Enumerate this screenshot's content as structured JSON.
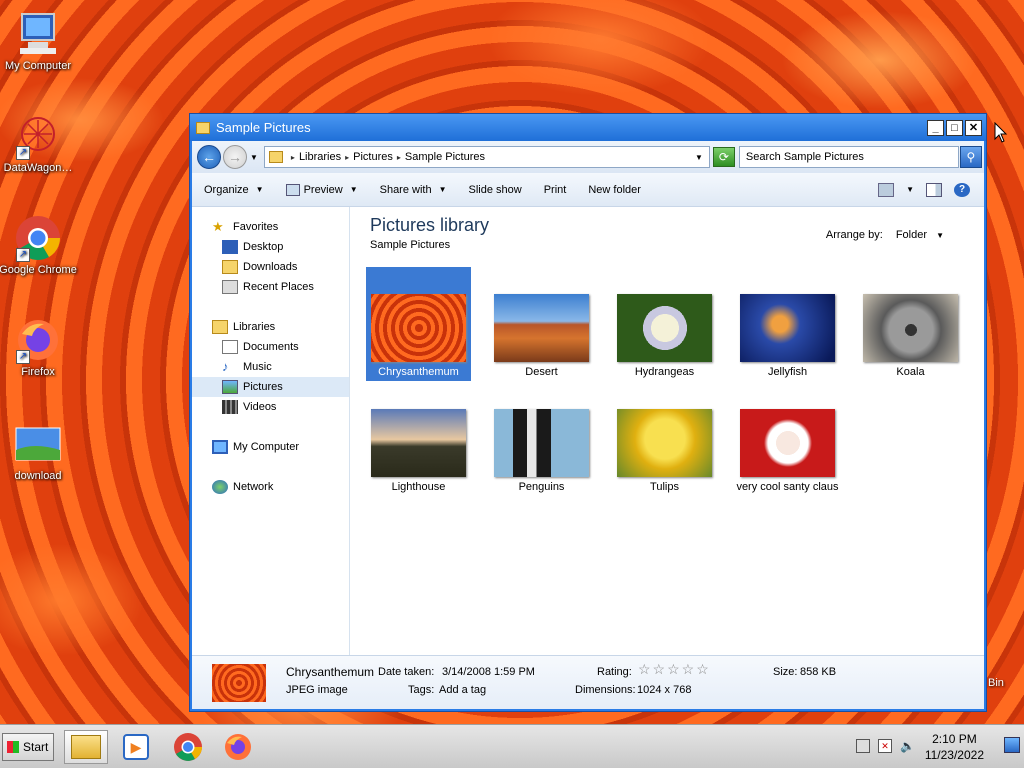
{
  "desktop": {
    "icons": [
      {
        "label": "My Computer",
        "icon": "computer-icon"
      },
      {
        "label": "DataWagon…",
        "icon": "datawagon-icon"
      },
      {
        "label": "Google Chrome",
        "icon": "chrome-icon"
      },
      {
        "label": "Firefox",
        "icon": "firefox-icon"
      },
      {
        "label": "download",
        "icon": "image-icon"
      }
    ],
    "recycle_bin_label": "Bin"
  },
  "window": {
    "title": "Sample Pictures",
    "controls": {
      "minimize": "_",
      "maximize": "□",
      "close": "✕"
    },
    "address": {
      "crumbs": [
        "Libraries",
        "Pictures",
        "Sample Pictures"
      ]
    },
    "search": {
      "placeholder": "Search Sample Pictures"
    },
    "toolbar": {
      "organize": "Organize",
      "preview": "Preview",
      "share_with": "Share with",
      "slide_show": "Slide show",
      "print": "Print",
      "new_folder": "New folder"
    },
    "nav": {
      "favorites": "Favorites",
      "desktop": "Desktop",
      "downloads": "Downloads",
      "recent_places": "Recent Places",
      "libraries": "Libraries",
      "documents": "Documents",
      "music": "Music",
      "pictures": "Pictures",
      "videos": "Videos",
      "my_computer": "My Computer",
      "network": "Network"
    },
    "content": {
      "title": "Pictures library",
      "subtitle": "Sample Pictures",
      "arrange_label": "Arrange by:",
      "arrange_value": "Folder",
      "items": [
        {
          "name": "Chrysanthemum",
          "selected": true
        },
        {
          "name": "Desert"
        },
        {
          "name": "Hydrangeas"
        },
        {
          "name": "Jellyfish"
        },
        {
          "name": "Koala"
        },
        {
          "name": "Lighthouse"
        },
        {
          "name": "Penguins"
        },
        {
          "name": "Tulips"
        },
        {
          "name": "very cool santy claus"
        }
      ]
    },
    "details": {
      "name": "Chrysanthemum",
      "type": "JPEG image",
      "date_taken_label": "Date taken:",
      "date_taken": "3/14/2008 1:59 PM",
      "tags_label": "Tags:",
      "tags_value": "Add a tag",
      "rating_label": "Rating:",
      "rating": 0,
      "dimensions_label": "Dimensions:",
      "dimensions": "1024 x 768",
      "size_label": "Size:",
      "size": "858 KB"
    }
  },
  "taskbar": {
    "start_label": "Start",
    "time": "2:10 PM",
    "date": "11/23/2022"
  }
}
